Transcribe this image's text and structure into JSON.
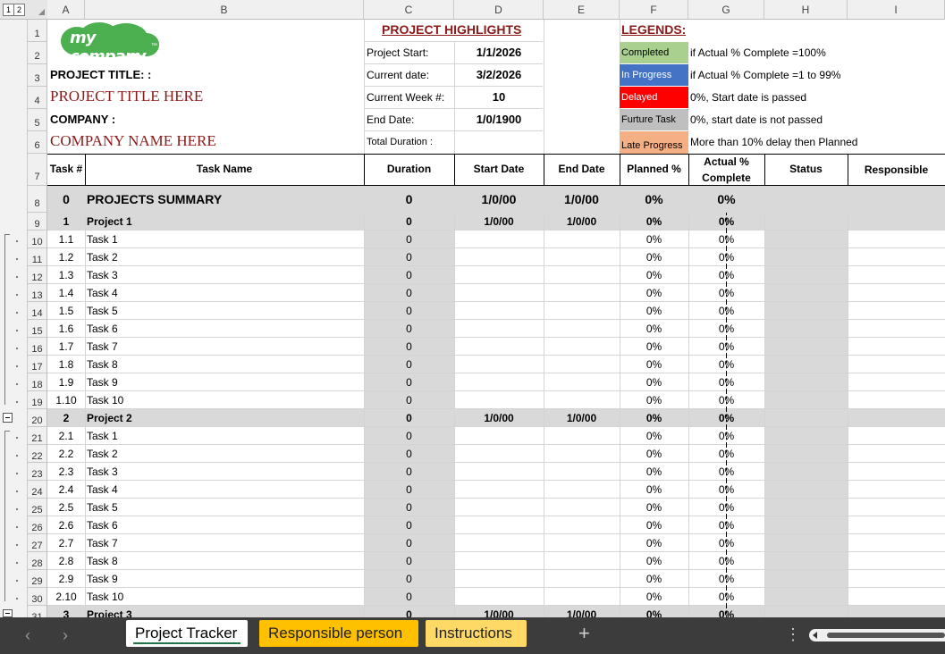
{
  "corner": {
    "levels": [
      "1",
      "2"
    ]
  },
  "columns": [
    "A",
    "B",
    "C",
    "D",
    "E",
    "F",
    "G",
    "H",
    "I"
  ],
  "logo": {
    "text": "my company",
    "tm": "™"
  },
  "highlights": {
    "title": "PROJECT HIGHLIGHTS",
    "project_start_label": "Project Start:",
    "project_start": "1/1/2026",
    "current_date_label": "Current date:",
    "current_date": "3/2/2026",
    "current_week_label": "Current Week #:",
    "current_week": "10",
    "end_date_label": "End Date:",
    "end_date": "1/0/1900",
    "total_duration_label": "Total Duration :"
  },
  "legends": {
    "title": "LEGENDS:",
    "items": [
      {
        "label": "Completed",
        "desc": "if Actual % Complete  =100%",
        "color": "#a9d08e",
        "text_color": "#000000"
      },
      {
        "label": "In Progress",
        "desc": "if Actual % Complete  =1 to 99%",
        "color": "#4472c4",
        "text_color": "#ffffff"
      },
      {
        "label": "Delayed",
        "desc": "0%, Start date is passed",
        "color": "#ff0000",
        "text_color": "#ffffff"
      },
      {
        "label": "Furture Task",
        "desc": "0%, start date is not passed",
        "color": "#bfbfbf",
        "text_color": "#000000"
      },
      {
        "label": "Late Progress",
        "desc": "More than 10% delay then Planned",
        "color": "#f4b084",
        "text_color": "#000000"
      }
    ]
  },
  "project": {
    "title_label": "PROJECT TITLE: :",
    "title_value": "PROJECT TITLE HERE",
    "company_label": "COMPANY :",
    "company_value": "COMPANY NAME HERE"
  },
  "table": {
    "headers": {
      "task_num": "Task #",
      "task_name": "Task Name",
      "duration": "Duration",
      "start_date": "Start Date",
      "end_date": "End Date",
      "planned": "Planned %",
      "actual_line1": "Actual %",
      "actual_line2": "Complete",
      "status": "Status",
      "responsible": "Responsible"
    },
    "summary": {
      "num": "0",
      "name": "PROJECTS SUMMARY",
      "duration": "0",
      "start": "1/0/00",
      "end": "1/0/00",
      "planned": "0%",
      "actual": "0%"
    },
    "rows": [
      {
        "row": "9",
        "num": "1",
        "name": "Project 1",
        "duration": "0",
        "start": "1/0/00",
        "end": "1/0/00",
        "planned": "0%",
        "actual": "0%",
        "type": "project"
      },
      {
        "row": "10",
        "num": "1.1",
        "name": "Task 1",
        "duration": "0",
        "start": "",
        "end": "",
        "planned": "0%",
        "actual": "0%",
        "type": "task"
      },
      {
        "row": "11",
        "num": "1.2",
        "name": "Task 2",
        "duration": "0",
        "start": "",
        "end": "",
        "planned": "0%",
        "actual": "0%",
        "type": "task"
      },
      {
        "row": "12",
        "num": "1.3",
        "name": "Task 3",
        "duration": "0",
        "start": "",
        "end": "",
        "planned": "0%",
        "actual": "0%",
        "type": "task"
      },
      {
        "row": "13",
        "num": "1.4",
        "name": "Task 4",
        "duration": "0",
        "start": "",
        "end": "",
        "planned": "0%",
        "actual": "0%",
        "type": "task"
      },
      {
        "row": "14",
        "num": "1.5",
        "name": "Task 5",
        "duration": "0",
        "start": "",
        "end": "",
        "planned": "0%",
        "actual": "0%",
        "type": "task"
      },
      {
        "row": "15",
        "num": "1.6",
        "name": "Task 6",
        "duration": "0",
        "start": "",
        "end": "",
        "planned": "0%",
        "actual": "0%",
        "type": "task"
      },
      {
        "row": "16",
        "num": "1.7",
        "name": "Task 7",
        "duration": "0",
        "start": "",
        "end": "",
        "planned": "0%",
        "actual": "0%",
        "type": "task"
      },
      {
        "row": "17",
        "num": "1.8",
        "name": "Task 8",
        "duration": "0",
        "start": "",
        "end": "",
        "planned": "0%",
        "actual": "0%",
        "type": "task"
      },
      {
        "row": "18",
        "num": "1.9",
        "name": "Task 9",
        "duration": "0",
        "start": "",
        "end": "",
        "planned": "0%",
        "actual": "0%",
        "type": "task"
      },
      {
        "row": "19",
        "num": "1.10",
        "name": "Task 10",
        "duration": "0",
        "start": "",
        "end": "",
        "planned": "0%",
        "actual": "0%",
        "type": "task"
      },
      {
        "row": "20",
        "num": "2",
        "name": "Project 2",
        "duration": "0",
        "start": "1/0/00",
        "end": "1/0/00",
        "planned": "0%",
        "actual": "0%",
        "type": "project"
      },
      {
        "row": "21",
        "num": "2.1",
        "name": "Task 1",
        "duration": "0",
        "start": "",
        "end": "",
        "planned": "0%",
        "actual": "0%",
        "type": "task"
      },
      {
        "row": "22",
        "num": "2.2",
        "name": "Task 2",
        "duration": "0",
        "start": "",
        "end": "",
        "planned": "0%",
        "actual": "0%",
        "type": "task"
      },
      {
        "row": "23",
        "num": "2.3",
        "name": "Task 3",
        "duration": "0",
        "start": "",
        "end": "",
        "planned": "0%",
        "actual": "0%",
        "type": "task"
      },
      {
        "row": "24",
        "num": "2.4",
        "name": "Task 4",
        "duration": "0",
        "start": "",
        "end": "",
        "planned": "0%",
        "actual": "0%",
        "type": "task"
      },
      {
        "row": "25",
        "num": "2.5",
        "name": "Task 5",
        "duration": "0",
        "start": "",
        "end": "",
        "planned": "0%",
        "actual": "0%",
        "type": "task"
      },
      {
        "row": "26",
        "num": "2.6",
        "name": "Task 6",
        "duration": "0",
        "start": "",
        "end": "",
        "planned": "0%",
        "actual": "0%",
        "type": "task"
      },
      {
        "row": "27",
        "num": "2.7",
        "name": "Task 7",
        "duration": "0",
        "start": "",
        "end": "",
        "planned": "0%",
        "actual": "0%",
        "type": "task"
      },
      {
        "row": "28",
        "num": "2.8",
        "name": "Task 8",
        "duration": "0",
        "start": "",
        "end": "",
        "planned": "0%",
        "actual": "0%",
        "type": "task"
      },
      {
        "row": "29",
        "num": "2.9",
        "name": "Task 9",
        "duration": "0",
        "start": "",
        "end": "",
        "planned": "0%",
        "actual": "0%",
        "type": "task"
      },
      {
        "row": "30",
        "num": "2.10",
        "name": "Task 10",
        "duration": "0",
        "start": "",
        "end": "",
        "planned": "0%",
        "actual": "0%",
        "type": "task"
      },
      {
        "row": "31",
        "num": "3",
        "name": "Project 3",
        "duration": "0",
        "start": "1/0/00",
        "end": "1/0/00",
        "planned": "0%",
        "actual": "0%",
        "type": "project"
      }
    ]
  },
  "tabs": {
    "active": "Project Tracker",
    "items": [
      {
        "label": "Project Tracker",
        "color": "#ffffff"
      },
      {
        "label": "Responsible person",
        "color": "#ffc000"
      },
      {
        "label": "Instructions",
        "color": "#ffd966"
      }
    ],
    "add": "+",
    "more": "⋮"
  },
  "colors": {
    "title_red": "#8b1a1a",
    "header_gray": "#d9d9d9"
  }
}
